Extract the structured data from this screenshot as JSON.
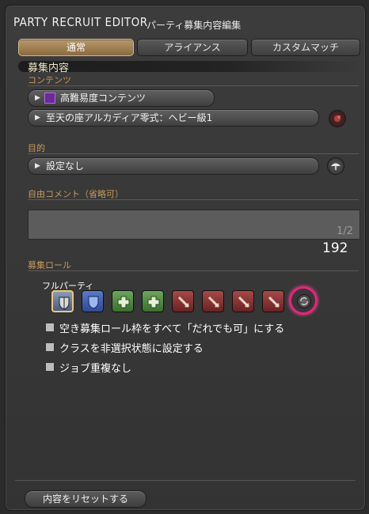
{
  "window": {
    "title_en": "PARTY RECRUIT EDITOR",
    "title_ja": "パーティ募集内容編集"
  },
  "tabs": [
    {
      "label": "通常",
      "active": true
    },
    {
      "label": "アライアンス",
      "active": false
    },
    {
      "label": "カスタムマッチ",
      "active": false
    }
  ],
  "recruit": {
    "heading": "募集内容",
    "contents_label": "コンテンツ",
    "content_type": "高難易度コンテンツ",
    "duty": "至天の座アルカディア零式：ヘビー級1",
    "purpose_label": "目的",
    "purpose": "設定なし",
    "comment_label": "自由コメント（省略可）",
    "comment_value": "",
    "comment_page": "1/2",
    "char_count": "192"
  },
  "roles": {
    "heading": "募集ロール",
    "party_type": "フルパーティ",
    "slots": [
      {
        "role": "any-tank",
        "icon": "tank-shield-icon",
        "selected": true
      },
      {
        "role": "tank",
        "icon": "tank-shield-icon",
        "selected": false
      },
      {
        "role": "healer",
        "icon": "healer-cross-icon",
        "selected": false
      },
      {
        "role": "healer",
        "icon": "healer-cross-icon",
        "selected": false
      },
      {
        "role": "dps",
        "icon": "dps-sword-icon",
        "selected": false
      },
      {
        "role": "dps",
        "icon": "dps-sword-icon",
        "selected": false
      },
      {
        "role": "dps",
        "icon": "dps-sword-icon",
        "selected": false
      },
      {
        "role": "dps",
        "icon": "dps-sword-icon",
        "selected": false
      }
    ],
    "highlight_color": "#e8237a"
  },
  "options": [
    {
      "label": "空き募集ロール枠をすべて「だれでも可」にする",
      "checked": false
    },
    {
      "label": "クラスを非選択状態に設定する",
      "checked": false
    },
    {
      "label": "ジョブ重複なし",
      "checked": false
    }
  ],
  "footer": {
    "reset_label": "内容をリセットする"
  }
}
